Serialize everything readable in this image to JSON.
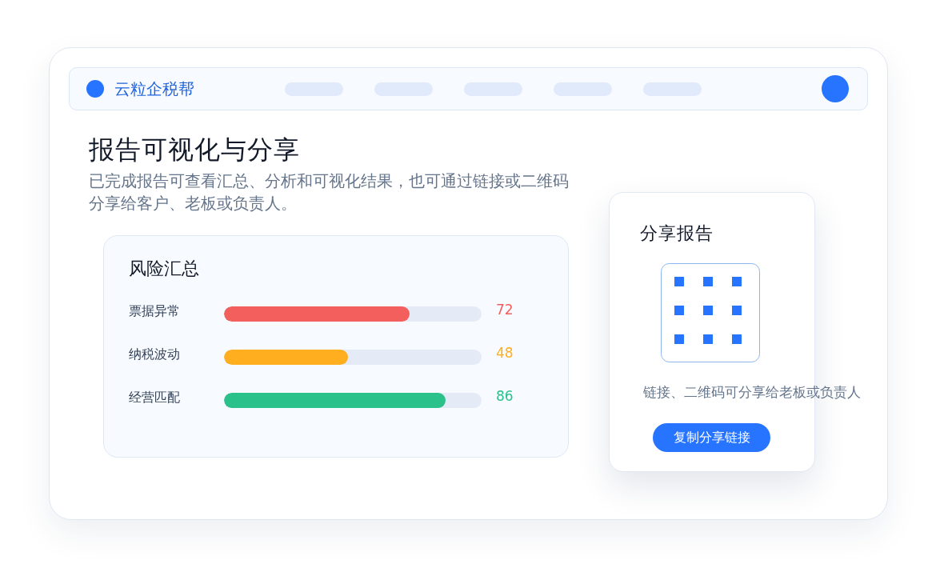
{
  "app_bar": {
    "brand": "云粒企税帮"
  },
  "header": {
    "title": "报告可视化与分享",
    "description": "已完成报告可查看汇总、分析和可视化结果，也可通过链接或二维码分享给客户、老板或负责人。"
  },
  "risk_summary": {
    "title": "风险汇总",
    "items": [
      {
        "label": "票据异常",
        "value": "72",
        "level": 0.72,
        "color": "#f25f5c"
      },
      {
        "label": "纳税波动",
        "value": "48",
        "level": 0.48,
        "color": "#ffae1f"
      },
      {
        "label": "经营匹配",
        "value": "86",
        "level": 0.86,
        "color": "#2bc18b"
      }
    ]
  },
  "share_panel": {
    "title": "分享报告",
    "caption": "链接、二维码可分享给老板或负责人",
    "button": "复制分享链接"
  }
}
